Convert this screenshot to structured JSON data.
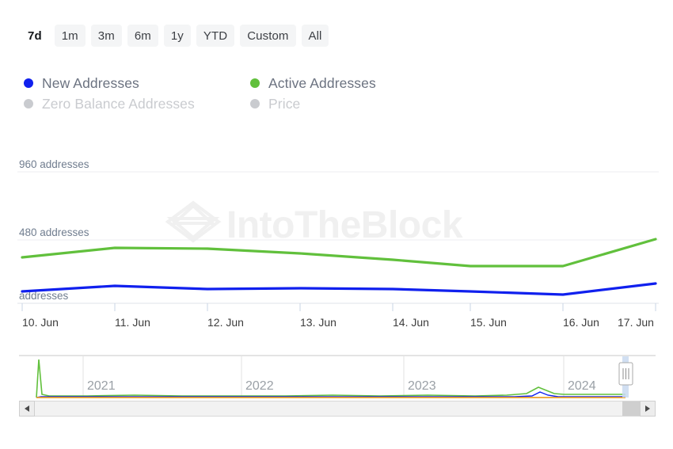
{
  "range_selector": {
    "options": [
      {
        "label": "7d",
        "selected": true
      },
      {
        "label": "1m",
        "selected": false
      },
      {
        "label": "3m",
        "selected": false
      },
      {
        "label": "6m",
        "selected": false
      },
      {
        "label": "1y",
        "selected": false
      },
      {
        "label": "YTD",
        "selected": false
      },
      {
        "label": "Custom",
        "selected": false
      },
      {
        "label": "All",
        "selected": false
      }
    ]
  },
  "legend": {
    "items": [
      {
        "label": "New Addresses",
        "color": "#1020ee",
        "active": true
      },
      {
        "label": "Active Addresses",
        "color": "#61c03c",
        "active": true
      },
      {
        "label": "Zero Balance Addresses",
        "color": "#c9cbcf",
        "active": false
      },
      {
        "label": "Price",
        "color": "#c9cbcf",
        "active": false
      }
    ]
  },
  "watermark": {
    "text": "IntoTheBlock",
    "logo_icon": "intotheblock-diamond-logo",
    "color": "#f0f0f0"
  },
  "navigator": {
    "year_labels": [
      "2021",
      "2022",
      "2023",
      "2024"
    ],
    "handle_icon": "range-handle-grip",
    "series_colors": {
      "price": "#eda128",
      "active": "#61c03c",
      "new": "#1020ee"
    }
  },
  "scrollbar": {
    "left_arrow_icon": "triangle-left-icon",
    "right_arrow_icon": "triangle-right-icon"
  },
  "chart_data": {
    "type": "line",
    "title": "",
    "xlabel": "",
    "ylabel": "addresses",
    "grid": true,
    "legend_position": "top-left",
    "x": [
      "10. Jun",
      "11. Jun",
      "12. Jun",
      "13. Jun",
      "14. Jun",
      "15. Jun",
      "16. Jun",
      "17. Jun"
    ],
    "ytick_labels": [
      "960 addresses",
      "480 addresses",
      "addresses"
    ],
    "ytick_values": [
      960,
      480,
      0
    ],
    "ylim": [
      0,
      1100
    ],
    "series": [
      {
        "name": "Active Addresses",
        "color": "#61c03c",
        "values": [
          350,
          420,
          415,
          378,
          330,
          282,
          282,
          487
        ]
      },
      {
        "name": "New Addresses",
        "color": "#1020ee",
        "values": [
          90,
          132,
          108,
          114,
          108,
          90,
          66,
          150
        ]
      }
    ],
    "hidden_series": [
      {
        "name": "Zero Balance Addresses",
        "color": "#c9cbcf"
      },
      {
        "name": "Price",
        "color": "#c9cbcf"
      }
    ]
  }
}
